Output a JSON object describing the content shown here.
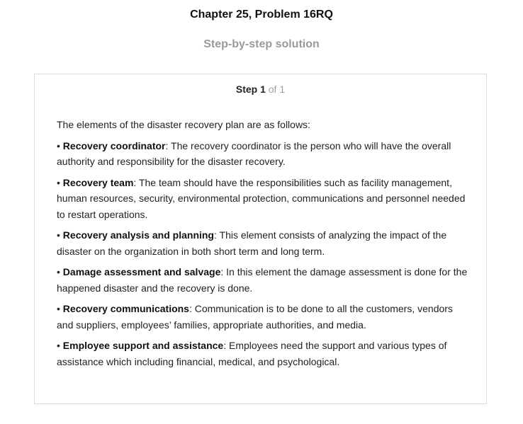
{
  "header": {
    "title": "Chapter 25, Problem 16RQ",
    "subtitle": "Step-by-step solution"
  },
  "step": {
    "label": "Step 1",
    "count": "of 1"
  },
  "content": {
    "intro": "The elements of the disaster recovery plan are as follows:",
    "bullet": "•",
    "items": [
      {
        "term": "Recovery coordinator",
        "text": ": The recovery coordinator is the person who will have the overall authority and responsibility for the disaster recovery."
      },
      {
        "term": "Recovery team",
        "text": ": The team should have the responsibilities such as facility management, human resources, security, environmental protection, communications and personnel needed to restart operations."
      },
      {
        "term": "Recovery analysis and planning",
        "text": ": This element consists of analyzing the impact of the disaster on the organization in both short term and long term."
      },
      {
        "term": "Damage assessment and salvage",
        "text": ": In this element the damage assessment is done for the happened disaster and the recovery is done."
      },
      {
        "term": "Recovery communications",
        "text": ": Communication is to be done to all the customers, vendors and suppliers, employees’ families, appropriate authorities, and media."
      },
      {
        "term": "Employee support and assistance",
        "text": ": Employees need the support and various types of assistance which including financial, medical, and psychological."
      }
    ]
  }
}
